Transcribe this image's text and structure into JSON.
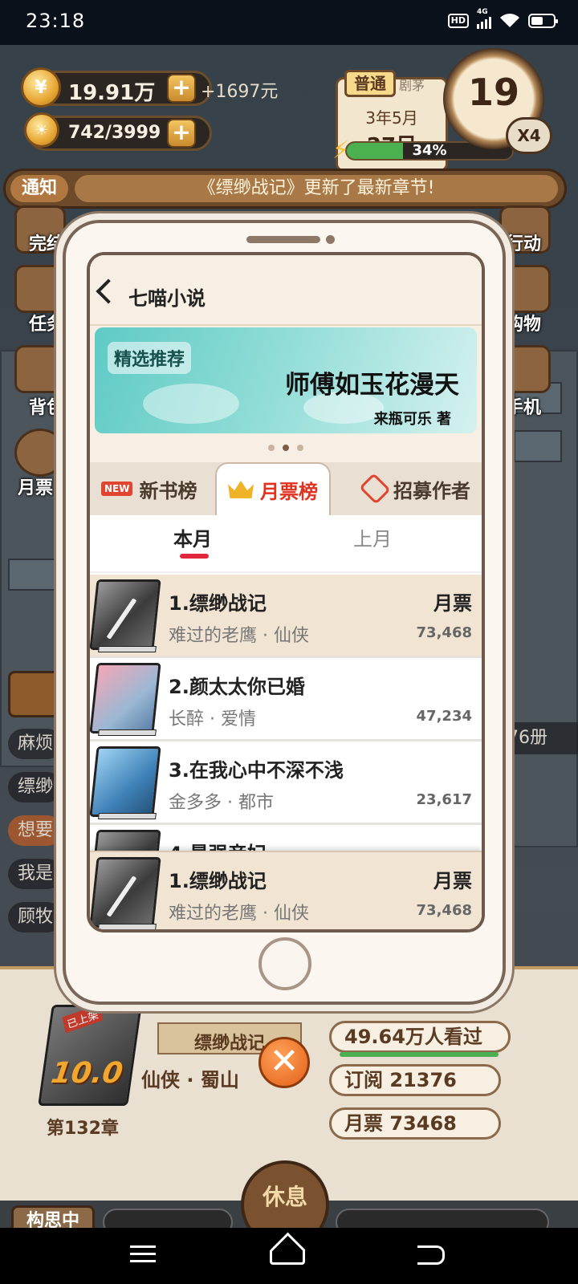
{
  "status_bar": {
    "time": "23:18",
    "network": "4G",
    "hd_label": "HD"
  },
  "hud": {
    "money": "19.91万",
    "money_gain": "+1697元",
    "energy": "742/3999",
    "rank": "普通",
    "rank_secondary": "剧茅",
    "date_year_month": "3年5月",
    "date_day": "27日",
    "progress_percent": "34%",
    "progress_fraction": 0.34,
    "level": "19",
    "speed": "X4"
  },
  "notice": {
    "tag": "通知",
    "message": "《缥缈战记》更新了最新章节!"
  },
  "side_left": [
    "完结",
    "任务",
    "背包",
    "月票"
  ],
  "side_right": [
    "行动",
    "购物",
    "手机"
  ],
  "side_right_counter": "76册",
  "chat_lines": [
    "麻烦",
    "缥缈",
    "想要",
    "我是",
    "顾牧"
  ],
  "phone_app": {
    "title": "七喵小说",
    "banner": {
      "tag": "精选推荐",
      "book_title": "师傅如玉花漫天",
      "author": "来瓶可乐 著",
      "pages": 3,
      "active_page": 2
    },
    "tabs": {
      "new_badge": "NEW",
      "new_books": "新书榜",
      "monthly": "月票榜",
      "recruit": "招募作者"
    },
    "subtabs": {
      "this_month": "本月",
      "last_month": "上月"
    },
    "ranking": [
      {
        "name": "1.缥缈战记",
        "meta": "难过的老鹰 · 仙侠",
        "label": "月票",
        "votes": "73,468"
      },
      {
        "name": "2.颜太太你已婚",
        "meta": "长醉 · 爱情",
        "label": "",
        "votes": "47,234"
      },
      {
        "name": "3.在我心中不深不浅",
        "meta": "金多多 · 都市",
        "label": "",
        "votes": "23,617"
      },
      {
        "name": "4.最强帝妃",
        "meta": "",
        "label": "",
        "votes": ""
      }
    ],
    "my_book": {
      "name": "1.缥缈战记",
      "meta": "难过的老鹰 · 仙侠",
      "label": "月票",
      "votes": "73,468"
    }
  },
  "book_panel": {
    "ribbon": "已上架",
    "score": "10.0",
    "title": "缥缈战记",
    "genre": "仙侠 · 蜀山",
    "chapter": "第132章",
    "views": "49.64万人看过",
    "subs": "订阅 21376",
    "votes": "月票 73468",
    "status": "构思中",
    "rest": "休息"
  },
  "colors": {
    "accent_red": "#e2263b",
    "banner_teal": "#5fcac5",
    "wood": "#6d4a2a"
  }
}
